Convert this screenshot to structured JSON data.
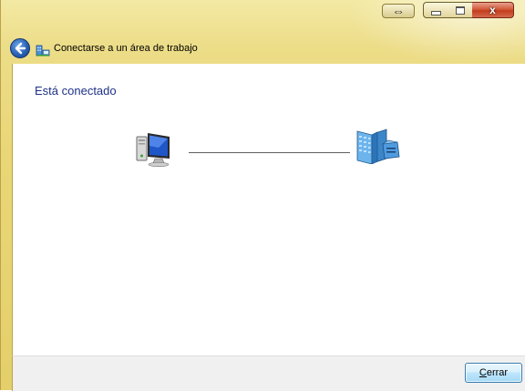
{
  "window": {
    "caption_buttons": {
      "resize_icon": "double-arrow-icon",
      "minimize_icon": "minimize-icon",
      "maximize_icon": "maximize-icon",
      "close_icon": "close-icon",
      "close_glyph": "x"
    }
  },
  "nav": {
    "back_icon": "back-arrow-icon",
    "app_icon": "workplace-connection-icon",
    "title": "Conectarse a un área de trabajo"
  },
  "content": {
    "heading": "Está conectado",
    "left_icon": "computer-icon",
    "right_icon": "network-server-icon"
  },
  "footer": {
    "close_button_access_key": "C",
    "close_button_rest": "errar"
  },
  "colors": {
    "frame": "#e9d676",
    "heading": "#1e3287",
    "close_red": "#c33e1e",
    "button_border": "#3c7fb1"
  }
}
